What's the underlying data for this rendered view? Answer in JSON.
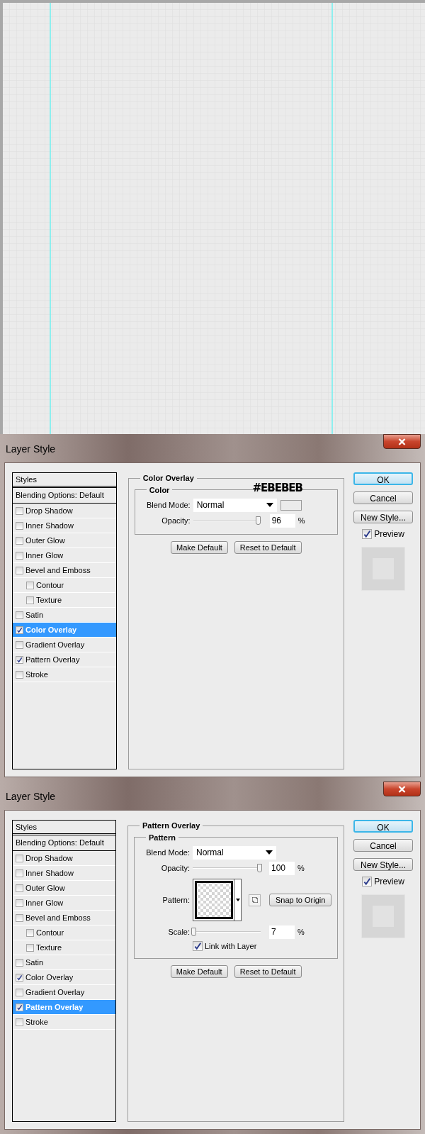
{
  "dialogs": [
    {
      "title": "Layer Style",
      "list_header": "Styles",
      "blending": "Blending Options: Default",
      "effects": [
        {
          "label": "Drop Shadow",
          "checked": false,
          "selected": false
        },
        {
          "label": "Inner Shadow",
          "checked": false,
          "selected": false
        },
        {
          "label": "Outer Glow",
          "checked": false,
          "selected": false
        },
        {
          "label": "Inner Glow",
          "checked": false,
          "selected": false
        },
        {
          "label": "Bevel and Emboss",
          "checked": false,
          "selected": false,
          "children": [
            {
              "label": "Contour",
              "checked": false,
              "selected": false
            },
            {
              "label": "Texture",
              "checked": false,
              "selected": false
            }
          ]
        },
        {
          "label": "Satin",
          "checked": false,
          "selected": false
        },
        {
          "label": "Color Overlay",
          "checked": true,
          "selected": true
        },
        {
          "label": "Gradient Overlay",
          "checked": false,
          "selected": false
        },
        {
          "label": "Pattern Overlay",
          "checked": true,
          "selected": false
        },
        {
          "label": "Stroke",
          "checked": false,
          "selected": false
        }
      ],
      "panel": {
        "title": "Color Overlay",
        "group": "Color",
        "annotation": "#EBEBEB",
        "rows": [
          {
            "kind": "select",
            "label": "Blend Mode:",
            "value": "Normal",
            "swatch": true
          },
          {
            "kind": "slider",
            "label": "Opacity:",
            "level": 0.96,
            "value": "96",
            "unit": "%"
          }
        ]
      },
      "panel_buttons": [
        "Make Default",
        "Reset to Default"
      ],
      "buttons": [
        {
          "label": "OK",
          "default": true
        },
        {
          "label": "Cancel",
          "default": false
        },
        {
          "label": "New Style...",
          "default": false
        }
      ],
      "preview": {
        "label": "Preview",
        "checked": true
      }
    },
    {
      "title": "Layer Style",
      "list_header": "Styles",
      "blending": "Blending Options: Default",
      "effects": [
        {
          "label": "Drop Shadow",
          "checked": false,
          "selected": false
        },
        {
          "label": "Inner Shadow",
          "checked": false,
          "selected": false
        },
        {
          "label": "Outer Glow",
          "checked": false,
          "selected": false
        },
        {
          "label": "Inner Glow",
          "checked": false,
          "selected": false
        },
        {
          "label": "Bevel and Emboss",
          "checked": false,
          "selected": false,
          "children": [
            {
              "label": "Contour",
              "checked": false,
              "selected": false
            },
            {
              "label": "Texture",
              "checked": false,
              "selected": false
            }
          ]
        },
        {
          "label": "Satin",
          "checked": false,
          "selected": false
        },
        {
          "label": "Color Overlay",
          "checked": true,
          "selected": false
        },
        {
          "label": "Gradient Overlay",
          "checked": false,
          "selected": false
        },
        {
          "label": "Pattern Overlay",
          "checked": true,
          "selected": true
        },
        {
          "label": "Stroke",
          "checked": false,
          "selected": false
        }
      ],
      "panel": {
        "title": "Pattern Overlay",
        "group": "Pattern",
        "rows": [
          {
            "kind": "select",
            "label": "Blend Mode:",
            "value": "Normal"
          },
          {
            "kind": "slider",
            "label": "Opacity:",
            "level": 0.99,
            "value": "100",
            "unit": "%"
          },
          {
            "kind": "pattern",
            "label": "Pattern:",
            "button": "Snap to Origin"
          },
          {
            "kind": "slider",
            "label": "Scale:",
            "level": 0.02,
            "value": "7",
            "unit": "%"
          },
          {
            "kind": "checkbox",
            "label": "Link with Layer",
            "checked": true
          }
        ]
      },
      "panel_buttons": [
        "Make Default",
        "Reset to Default"
      ],
      "buttons": [
        {
          "label": "OK",
          "default": true
        },
        {
          "label": "Cancel",
          "default": false
        },
        {
          "label": "New Style...",
          "default": false
        }
      ],
      "preview": {
        "label": "Preview",
        "checked": true
      }
    }
  ]
}
